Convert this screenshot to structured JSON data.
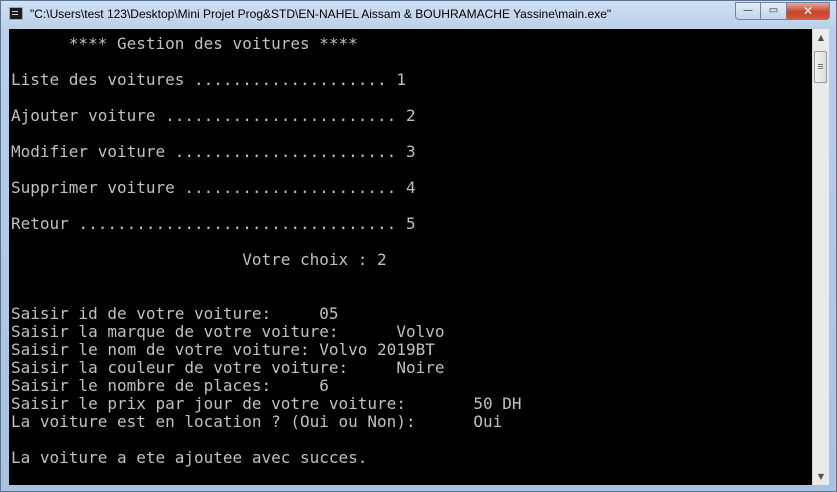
{
  "window": {
    "title": "\"C:\\Users\\test 123\\Desktop\\Mini Projet Prog&STD\\EN-NAHEL Aissam & BOUHRAMACHE Yassine\\main.exe\""
  },
  "caption_buttons": {
    "minimize": "—",
    "maximize": "▭",
    "close": "✕"
  },
  "scrollbar": {
    "up": "▲",
    "down": "▼"
  },
  "console": {
    "header": "      **** Gestion des voitures ****",
    "menu": [
      "Liste des voitures .................... 1",
      "Ajouter voiture ........................ 2",
      "Modifier voiture ....................... 3",
      "Supprimer voiture ...................... 4",
      "Retour ................................. 5"
    ],
    "choice": "                        Votre choix : 2",
    "prompts": [
      "Saisir id de votre voiture:     05",
      "Saisir la marque de votre voiture:      Volvo",
      "Saisir le nom de votre voiture: Volvo 2019BT",
      "Saisir la couleur de votre voiture:     Noire",
      "Saisir le nombre de places:     6",
      "Saisir le prix par jour de votre voiture:       50 DH",
      "La voiture est en location ? (Oui ou Non):      Oui"
    ],
    "result": "La voiture a ete ajoutee avec succes."
  }
}
